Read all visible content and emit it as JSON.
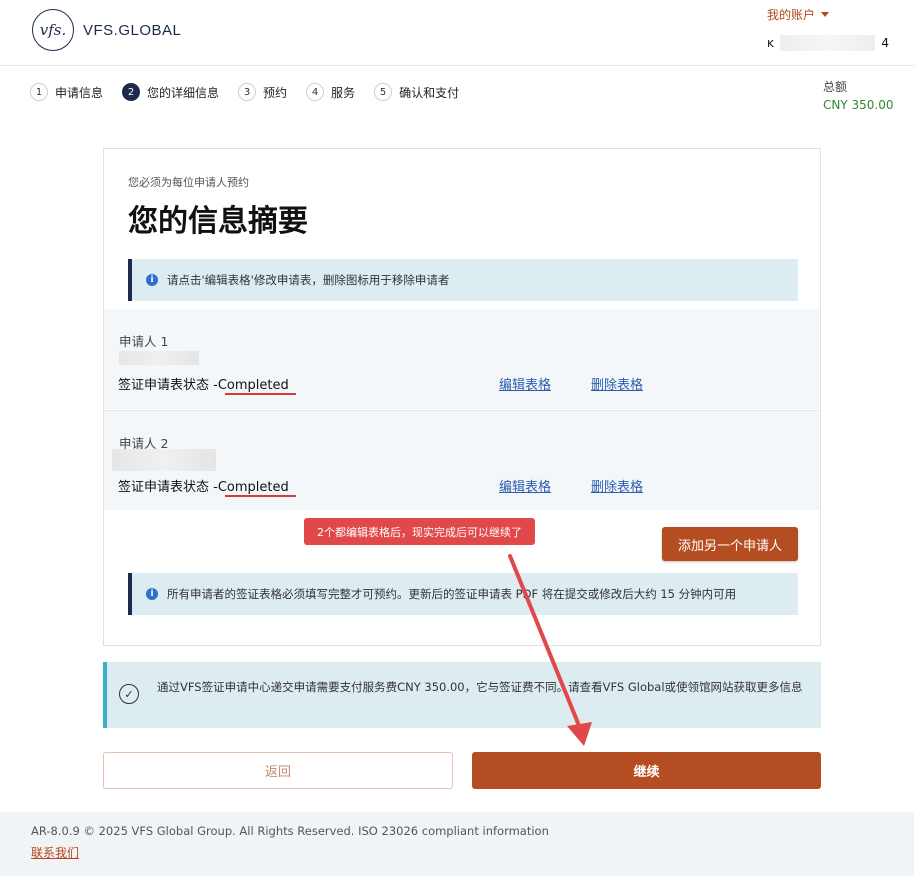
{
  "header": {
    "logo_mark": "vfs.",
    "logo_text": "VFS.GLOBAL",
    "account_label": "我的账户",
    "account_id_start": "ĸ",
    "account_id_end": "4"
  },
  "steps": [
    {
      "num": "1",
      "label": "申请信息"
    },
    {
      "num": "2",
      "label": "您的详细信息"
    },
    {
      "num": "3",
      "label": "预约"
    },
    {
      "num": "4",
      "label": "服务"
    },
    {
      "num": "5",
      "label": "确认和支付"
    }
  ],
  "total": {
    "label": "总额",
    "value": "CNY 350.00"
  },
  "summary": {
    "subtitle": "您必须为每位申请人预约",
    "title": "您的信息摘要",
    "info_top": "请点击'编辑表格'修改申请表，删除图标用于移除申请者",
    "info_bottom": "所有申请者的签证表格必须填写完整才可预约。更新后的签证申请表 PDF 将在提交或修改后大约 15 分钟内可用"
  },
  "applicants": [
    {
      "name": "申请人 1",
      "status": "签证申请表状态 -Completed",
      "edit_label": "编辑表格",
      "delete_label": "删除表格"
    },
    {
      "name": "申请人 2",
      "status": "签证申请表状态 -Completed",
      "edit_label": "编辑表格",
      "delete_label": "删除表格"
    }
  ],
  "add_applicant_label": "添加另一个申请人",
  "annotation": "2个都编辑表格后，现实完成后可以继续了",
  "notice": "通过VFS签证申请中心递交申请需要支付服务费CNY 350.00，它与签证费不同。请查看VFS Global或使领馆网站获取更多信息",
  "buttons": {
    "back": "返回",
    "continue": "继续"
  },
  "footer": {
    "copyright": "AR-8.0.9 © 2025 VFS Global Group. All Rights Reserved. ISO 23026 compliant information",
    "contact": "联系我们"
  },
  "colors": {
    "primary": "#b54d23",
    "navy": "#1d2a4b",
    "info_bg": "#dcecf1",
    "annotation_red": "#e0484a",
    "total_green": "#2f8a2f"
  }
}
